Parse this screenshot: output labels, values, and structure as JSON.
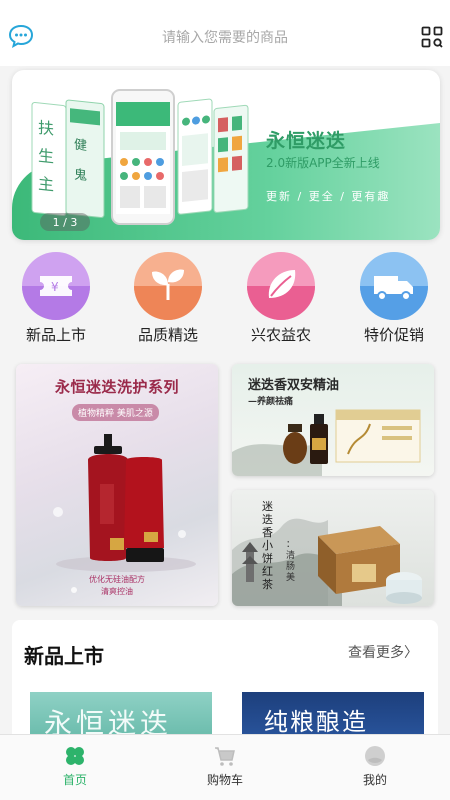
{
  "search": {
    "placeholder": "请输入您需要的商品"
  },
  "banner": {
    "title": "永恒迷迭",
    "subtitle": "2.0新版APP全新上线",
    "slogan": "更新 / 更全 / 更有趣",
    "pager": "1 / 3",
    "phone_text_1": "扶",
    "phone_text_2": "生",
    "phone_text_3": "主",
    "phone_text_4": "健",
    "phone_text_5": "鬼"
  },
  "categories": [
    {
      "label": "新品上市",
      "icon": "ticket-yen-icon",
      "color": "#b980e6"
    },
    {
      "label": "品质精选",
      "icon": "sprout-icon",
      "color": "#f08a5f"
    },
    {
      "label": "兴农益农",
      "icon": "leaf-icon",
      "color": "#ee6b9c"
    },
    {
      "label": "特价促销",
      "icon": "truck-icon",
      "color": "#5aa6ea"
    }
  ],
  "promos": {
    "large": {
      "title": "永恒迷迭洗护系列",
      "subtitle": "植物精粹 美肌之源",
      "foot1": "优化无硅油配方",
      "foot2": "清爽控油"
    },
    "small1": {
      "title": "迷迭香双安精油",
      "subtitle": "—养颜祛痛"
    },
    "small2": {
      "text_1": "迷迭香小饼红茶",
      "text_2": "：清肠美"
    }
  },
  "section": {
    "title": "新品上市",
    "more": "查看更多",
    "product1_text": "永恒迷迭",
    "product2_text": "纯粮酿造"
  },
  "tabbar": [
    {
      "label": "首页",
      "icon": "clover-icon",
      "active": true
    },
    {
      "label": "购物车",
      "icon": "cart-icon",
      "active": false
    },
    {
      "label": "我的",
      "icon": "user-icon",
      "active": false
    }
  ],
  "colors": {
    "accent": "#2db36b",
    "banner_green": "#3cb979"
  }
}
